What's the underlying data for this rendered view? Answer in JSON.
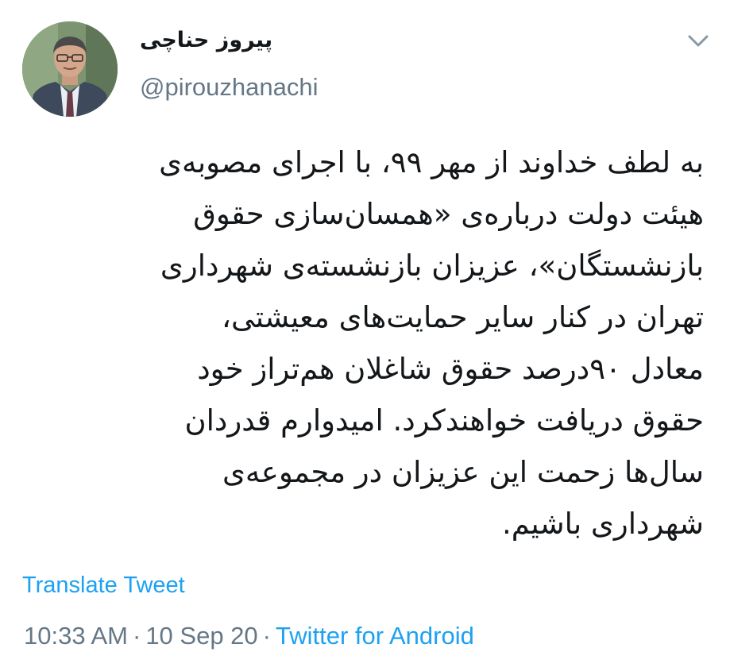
{
  "tweet": {
    "display_name": "پیروز حناچی",
    "handle": "@pirouzhanachi",
    "text_lines": [
      "به لطف خداوند از مهر ۹۹، با اجرای مصوبه‌ی",
      "هیئت دولت درباره‌ی «همسان‌سازی حقوق",
      "بازنشستگان»، عزیزان بازنشسته‌ی شهرداری",
      "تهران در کنار سایر حمایت‌های معیشتی،",
      "معادل ۹۰درصد حقوق شاغلان هم‌تراز خود",
      "حقوق دریافت خواهندکرد. امیدوارم قدردان",
      "سال‌ها زحمت این عزیزان در مجموعه‌ی",
      "شهرداری باشیم."
    ],
    "translate_label": "Translate Tweet",
    "time": "10:33 AM",
    "separator": "·",
    "date": "10 Sep 20",
    "source": "Twitter for Android"
  },
  "icons": {
    "menu": "chevron-down-icon",
    "avatar": "profile-photo"
  },
  "colors": {
    "link": "#1da1f2",
    "muted": "#657786",
    "text": "#14171a"
  }
}
